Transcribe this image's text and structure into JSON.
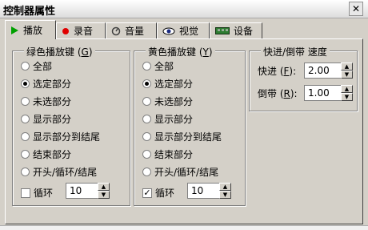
{
  "window": {
    "title": "控制器属性",
    "close_label": "✕"
  },
  "tabs": [
    {
      "label": "播放",
      "icon": "play-icon",
      "color": "#00a000",
      "active": true
    },
    {
      "label": "录音",
      "icon": "record-icon",
      "color": "#e00000"
    },
    {
      "label": "音量",
      "icon": "volume-icon"
    },
    {
      "label": "视觉",
      "icon": "eye-icon"
    },
    {
      "label": "设备",
      "icon": "device-icon"
    }
  ],
  "green_keys": {
    "legend_pre": "绿色播放键 (",
    "legend_key": "G",
    "legend_post": ")",
    "options": [
      "全部",
      "选定部分",
      "未选部分",
      "显示部分",
      "显示部分到结尾",
      "结束部分",
      "开头/循环/结尾"
    ],
    "selected_index": 1,
    "loop_label": "循环",
    "loop_checked": false,
    "loop_value": "10"
  },
  "yellow_keys": {
    "legend_pre": "黄色播放键 (",
    "legend_key": "Y",
    "legend_post": ")",
    "options": [
      "全部",
      "选定部分",
      "未选部分",
      "显示部分",
      "显示部分到结尾",
      "结束部分",
      "开头/循环/结尾"
    ],
    "selected_index": 1,
    "loop_label": "循环",
    "loop_checked": true,
    "loop_value": "10"
  },
  "speed": {
    "legend": "快进/倒带 速度",
    "forward_pre": "快进 (",
    "forward_key": "F",
    "forward_post": "):",
    "forward_value": "2.00",
    "rewind_pre": "倒带 (",
    "rewind_key": "R",
    "rewind_post": "):",
    "rewind_value": "1.00"
  },
  "colors": {
    "face": "#d4d0c8",
    "shadow": "#808080",
    "highlight": "#ffffff"
  }
}
